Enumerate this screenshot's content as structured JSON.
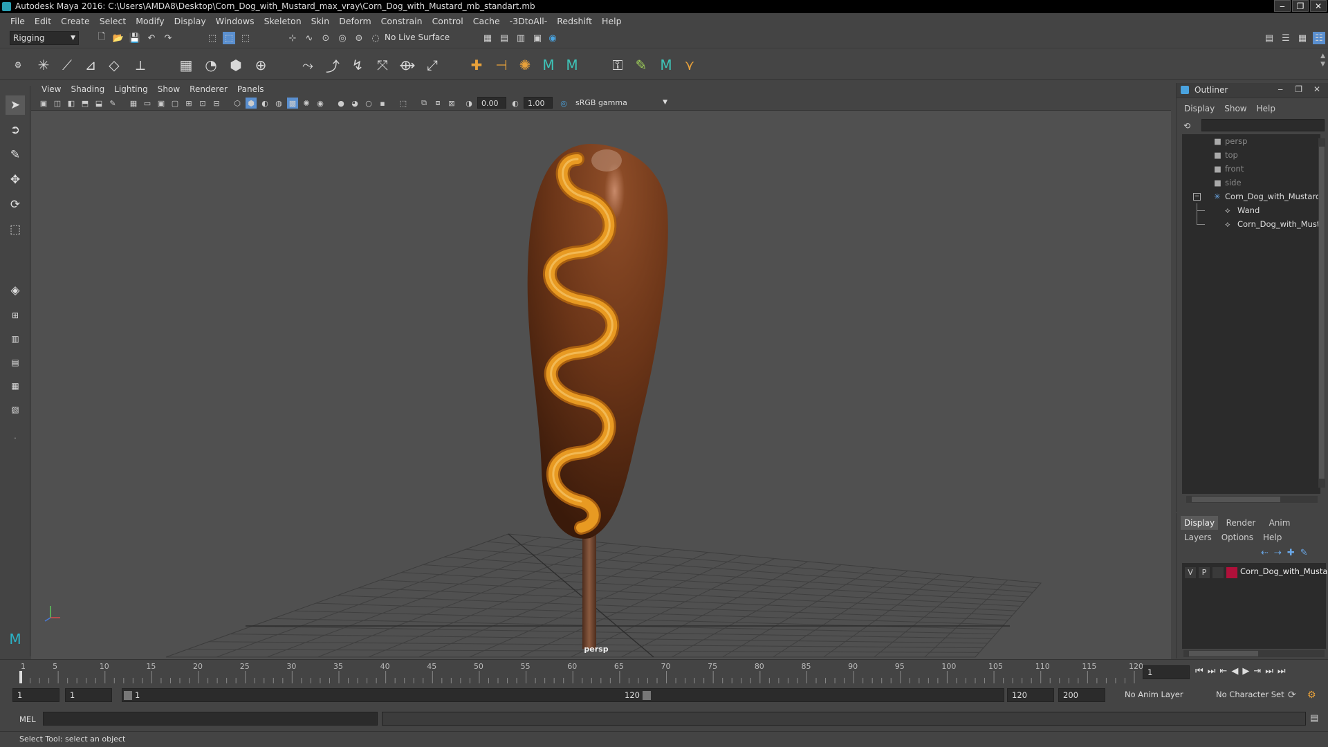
{
  "window": {
    "title": "Autodesk Maya 2016: C:\\Users\\AMDA8\\Desktop\\Corn_Dog_with_Mustard_max_vray\\Corn_Dog_with_Mustard_mb_standart.mb",
    "controls": [
      "‒",
      "❐",
      "✕"
    ]
  },
  "menubar": [
    "File",
    "Edit",
    "Create",
    "Select",
    "Modify",
    "Display",
    "Windows",
    "Skeleton",
    "Skin",
    "Deform",
    "Constrain",
    "Control",
    "Cache",
    "-3DtoAll-",
    "Redshift",
    "Help"
  ],
  "statusline": {
    "menuset": "Rigging",
    "live_surface": "No Live Surface"
  },
  "panel": {
    "menus": [
      "View",
      "Shading",
      "Lighting",
      "Show",
      "Renderer",
      "Panels"
    ],
    "exposure": "0.00",
    "gamma": "1.00",
    "colorspace": "sRGB gamma",
    "camera": "persp"
  },
  "outliner": {
    "title": "Outliner",
    "menus": [
      "Display",
      "Show",
      "Help"
    ],
    "items": [
      {
        "label": "persp",
        "icon": "camera-icon",
        "dim": true
      },
      {
        "label": "top",
        "icon": "camera-icon",
        "dim": true
      },
      {
        "label": "front",
        "icon": "camera-icon",
        "dim": true
      },
      {
        "label": "side",
        "icon": "camera-icon",
        "dim": true
      },
      {
        "label": "Corn_Dog_with_Mustard_",
        "icon": "group-icon",
        "dim": false
      },
      {
        "label": "Wand",
        "icon": "mesh-icon",
        "dim": false
      },
      {
        "label": "Corn_Dog_with_Must",
        "icon": "mesh-icon",
        "dim": false
      }
    ]
  },
  "layers": {
    "tabs": [
      "Display",
      "Render",
      "Anim"
    ],
    "menus": [
      "Layers",
      "Options",
      "Help"
    ],
    "row": {
      "v": "V",
      "p": "P",
      "name": "Corn_Dog_with_Musta",
      "color": "#b0103a"
    }
  },
  "timeline": {
    "ticks": [
      "1",
      "5",
      "10",
      "15",
      "20",
      "25",
      "30",
      "35",
      "40",
      "45",
      "50",
      "55",
      "60",
      "65",
      "70",
      "75",
      "80",
      "85",
      "90",
      "95",
      "100",
      "105",
      "110",
      "115",
      "120"
    ],
    "current_frame": "1"
  },
  "range": {
    "start": "1",
    "playback_start": "1",
    "slider_start": "1",
    "slider_end": "120",
    "playback_end": "120",
    "end": "200",
    "anim_layer": "No Anim Layer",
    "char_set": "No Character Set"
  },
  "cmd": {
    "lang": "MEL"
  },
  "help": {
    "text": "Select Tool: select an object"
  },
  "colors": {
    "mustard": "#e89a22",
    "cornbread": "#6b3518",
    "stick": "#7a4a32",
    "accent": "#5a8fcf"
  }
}
